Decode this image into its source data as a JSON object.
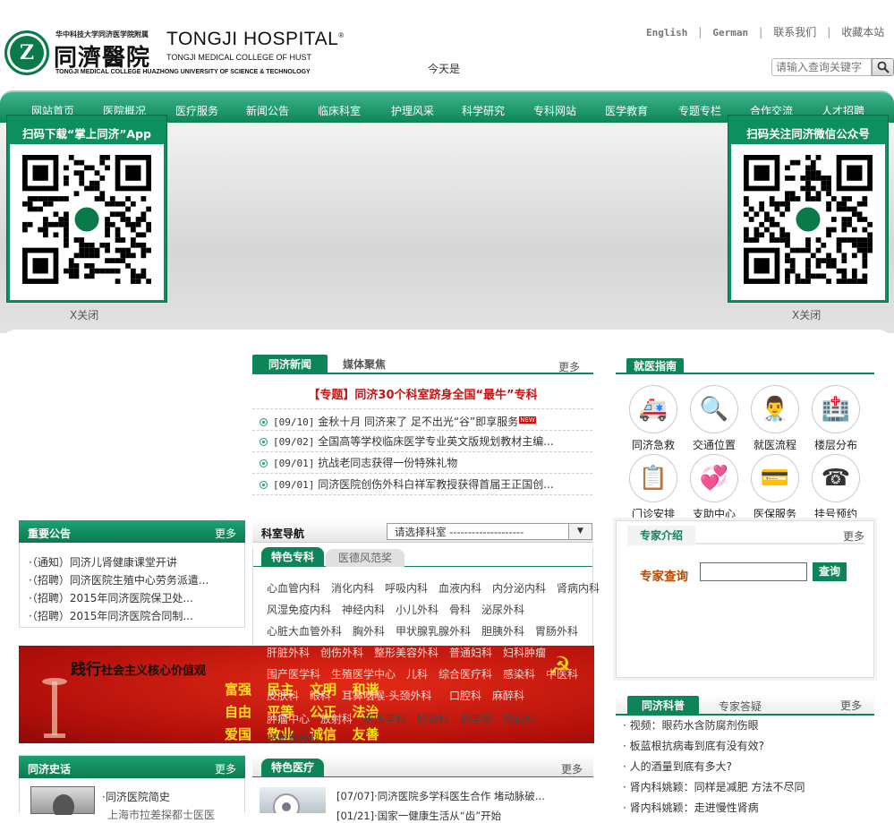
{
  "header": {
    "logo_mark": "Z",
    "logo_sub": "华中科技大学同济医学院附属",
    "logo_cn": "同濟醫院",
    "logo_en": "TONGJI HOSPITAL",
    "logo_reg": "®",
    "logo_en2": "TONGJI MEDICAL COLLEGE OF HUST",
    "logo_en3": "TONGJI MEDICAL COLLEGE HUAZHONG UNIVERSITY OF SCIENCE & TECHNOLOGY",
    "links": [
      "English",
      "German",
      "联系我们",
      "收藏本站"
    ],
    "link_sep": "|",
    "today": "今天是",
    "search_placeholder": "请输入查询关键字"
  },
  "nav": [
    "网站首页",
    "医院概况",
    "医疗服务",
    "新闻公告",
    "临床科室",
    "护理风采",
    "科学研究",
    "专科网站",
    "医学教育",
    "专题专栏",
    "合作交流",
    "人才招聘"
  ],
  "qr_left": {
    "title": "扫码下载“掌上同济”App",
    "close": "X关闭"
  },
  "qr_right": {
    "title": "扫码关注同济微信公众号",
    "close": "X关闭"
  },
  "news": {
    "tabs": [
      "同济新闻",
      "媒体聚焦"
    ],
    "more": "更多",
    "headline": "【专题】同济30个科室跻身全国“最牛”专科",
    "new_badge": "NEW",
    "items": [
      {
        "date": "[09/10]",
        "title": "金秋十月  同济来了  足不出光“谷”即享服务"
      },
      {
        "date": "[09/02]",
        "title": "全国高等学校临床医学专业英文版规划教材主编..."
      },
      {
        "date": "[09/01]",
        "title": "抗战老同志获得一份特殊礼物"
      },
      {
        "date": "[09/01]",
        "title": "同济医院创伤外科白祥军教授获得首届王正国创..."
      }
    ]
  },
  "guide": {
    "title": "就医指南",
    "items": [
      "同济急救",
      "交通位置",
      "就医流程",
      "楼层分布",
      "门诊安排",
      "支助中心",
      "医保服务",
      "挂号预约"
    ]
  },
  "notice": {
    "title": "重要公告",
    "more": "更多",
    "items": [
      "·（通知）同济儿肾健康课堂开讲",
      "·（招聘）同济医院生殖中心劳务派遣...",
      "·（招聘）2015年同济医院保卫处...",
      "·（招聘）2015年同济医院合同制..."
    ]
  },
  "dept": {
    "title": "科室导航",
    "select": "请选择科室 --------------------",
    "tabs": [
      "特色专科",
      "医德风范奖"
    ],
    "rows": [
      [
        "心血管内科",
        "消化内科",
        "呼吸内科",
        "血液内科",
        "内分泌内科",
        "肾病内科"
      ],
      [
        "风湿免疫内科",
        "神经内科",
        "小儿外科",
        "骨科",
        "泌尿外科"
      ],
      [
        "心脏大血管外科",
        "胸外科",
        "甲状腺乳腺外科",
        "胆胰外科",
        "胃肠外科"
      ],
      [
        "肝脏外科",
        "创伤外科",
        "整形美容外科",
        "普通妇科",
        "妇科肿瘤"
      ],
      [
        "围产医学科",
        "生殖医学中心",
        "儿科",
        "综合医疗科",
        "感染科",
        "中医科"
      ],
      [
        "皮肤科",
        "眼科",
        "耳鼻咽喉-头颈外科",
        "口腔科",
        "麻醉科"
      ],
      [
        "肿瘤中心",
        "放射科",
        "核医学科",
        "检验科",
        "药学部",
        "输血科"
      ],
      [
        "超声影像科"
      ]
    ]
  },
  "expert": {
    "title": "专家介绍",
    "more": "更多",
    "query_label": "专家查询",
    "query_button": "查询"
  },
  "core_banner": {
    "heading_big": "践行",
    "heading": "社会主义核心价值观",
    "values": [
      "富强",
      "民主",
      "文明",
      "和谐",
      "自由",
      "平等",
      "公正",
      "法治",
      "爱国",
      "敬业",
      "诚信",
      "友善"
    ]
  },
  "history": {
    "title": "同济史话",
    "more": "更多",
    "items": [
      "·同济医院简史",
      "上海市拉差探都士医医"
    ]
  },
  "featured": {
    "title": "特色医疗",
    "more": "更多",
    "items": [
      "[07/07]·同济医院多学科医生合作  堵动脉破...",
      "[01/21]·国家一健康生活从“齿”开始"
    ]
  },
  "science": {
    "tabs": [
      "同济科普",
      "专家答疑"
    ],
    "more": "更多",
    "items": [
      "· 视频：眼药水含防腐剂伤眼",
      "· 板蓝根抗病毒到底有没有效?",
      "· 人的酒量到底有多大?",
      "· 肾内科姚颖：同样是减肥  方法不尽同",
      "· 肾内科姚颖：走进慢性肾病"
    ]
  },
  "colors": {
    "green": "#0d8559",
    "red": "#cc1111"
  }
}
